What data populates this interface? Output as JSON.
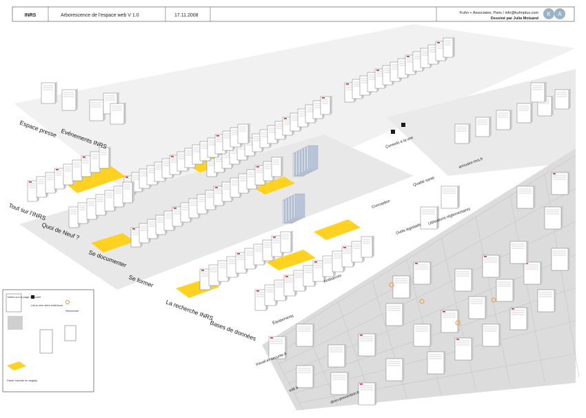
{
  "header": {
    "org": "INRS",
    "title": "Arborescence de l’espace web  V 1.0",
    "date": "17.11.2008",
    "agency": "Kuhn + Associates, Paris  /  info@kuhnplus.com",
    "author": "Dessiné par Julia Moisand",
    "logo_letters": [
      "K",
      "A"
    ]
  },
  "colors": {
    "background": "#ffffff",
    "floor": "#dcdcdc",
    "wall": "#cfcfcf",
    "card": "#ffffff",
    "card_edge": "#555555",
    "english_zone": "#ffd21f",
    "new_item_tag": "#d9251c",
    "link_badge": "#1a1a1a",
    "search_icon": "#f0a24a",
    "highlight_text": "#2a5db0"
  },
  "zones": [
    "Espace presse",
    "Evénements INRS",
    "Tout sur l’INRS",
    "Quoi de Neuf ?",
    "Se documenter",
    "Se former",
    "La recherche INRS",
    "Bases de données"
  ],
  "sites": [
    "Outils législatifs",
    "Ambiances",
    "Équipements",
    "Conception",
    "Qualité santé",
    "Utilisations réglementaires",
    "Conseils à la une",
    "travail-et-securite.fr",
    "ed6.fr",
    "annuaire-inrs.fr",
    "dexo-prevention.fr"
  ],
  "legend": {
    "sample_card": "Notes sur la page d’accueil",
    "link_label": "Liens vers sites extérieurs",
    "search_label": "Recherche",
    "english_label": "Partie traduite en anglais"
  }
}
